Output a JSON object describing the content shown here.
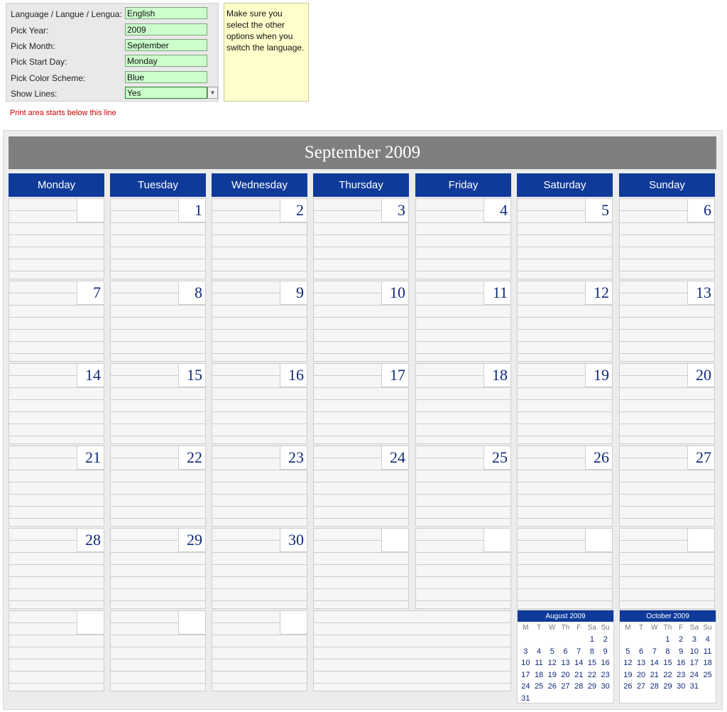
{
  "settings": {
    "fields": [
      {
        "label": "Language / Langue / Lengua:",
        "value": "English"
      },
      {
        "label": "Pick Year:",
        "value": "2009"
      },
      {
        "label": "Pick Month:",
        "value": "September"
      },
      {
        "label": "Pick Start Day:",
        "value": "Monday"
      },
      {
        "label": "Pick Color Scheme:",
        "value": "Blue"
      },
      {
        "label": "Show Lines:",
        "value": "Yes"
      }
    ],
    "note": "Make sure you select the other options when you switch the language.",
    "print_line": "Print area starts below this line"
  },
  "calendar": {
    "title": "September 2009",
    "days": [
      "Monday",
      "Tuesday",
      "Wednesday",
      "Thursday",
      "Friday",
      "Saturday",
      "Sunday"
    ],
    "weeks": [
      [
        "",
        "1",
        "2",
        "3",
        "4",
        "5",
        "6"
      ],
      [
        "7",
        "8",
        "9",
        "10",
        "11",
        "12",
        "13"
      ],
      [
        "14",
        "15",
        "16",
        "17",
        "18",
        "19",
        "20"
      ],
      [
        "21",
        "22",
        "23",
        "24",
        "25",
        "26",
        "27"
      ],
      [
        "28",
        "29",
        "30",
        "",
        "",
        "",
        ""
      ],
      [
        "",
        "",
        ""
      ]
    ]
  },
  "mini_calendars": [
    {
      "title": "August 2009",
      "headers": [
        "M",
        "T",
        "W",
        "Th",
        "F",
        "Sa",
        "Su"
      ],
      "cells": [
        "",
        "",
        "",
        "",
        "",
        "1",
        "2",
        "3",
        "4",
        "5",
        "6",
        "7",
        "8",
        "9",
        "10",
        "11",
        "12",
        "13",
        "14",
        "15",
        "16",
        "17",
        "18",
        "19",
        "20",
        "21",
        "22",
        "23",
        "24",
        "25",
        "26",
        "27",
        "28",
        "29",
        "30",
        "31",
        "",
        "",
        "",
        "",
        "",
        ""
      ]
    },
    {
      "title": "October 2009",
      "headers": [
        "M",
        "T",
        "W",
        "Th",
        "F",
        "Sa",
        "Su"
      ],
      "cells": [
        "",
        "",
        "",
        "1",
        "2",
        "3",
        "4",
        "5",
        "6",
        "7",
        "8",
        "9",
        "10",
        "11",
        "12",
        "13",
        "14",
        "15",
        "16",
        "17",
        "18",
        "19",
        "20",
        "21",
        "22",
        "23",
        "24",
        "25",
        "26",
        "27",
        "28",
        "29",
        "30",
        "31",
        ""
      ]
    }
  ],
  "colors": {
    "accent": "#0f3a99",
    "title_bar": "#7f7f7f",
    "input_bg": "#ccffcc",
    "note_bg": "#ffffcc",
    "print_line": "#cc0000"
  }
}
